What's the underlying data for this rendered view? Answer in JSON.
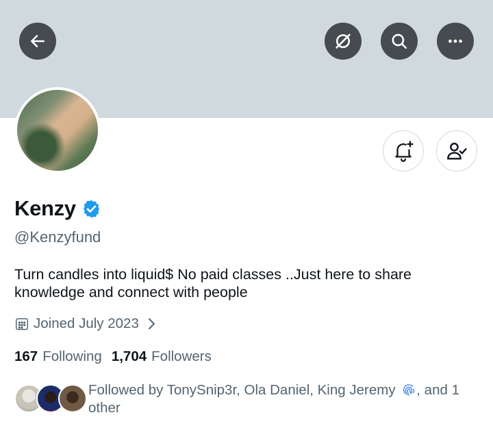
{
  "header": {
    "back_icon": "arrow-left-icon",
    "grok_icon": "grok-icon",
    "search_icon": "search-icon",
    "more_icon": "more-horizontal-icon"
  },
  "profile": {
    "display_name": "Kenzy",
    "handle": "@Kenzyfund",
    "bio_line1": "Turn candles into liquid$ No paid classes  ..Just here to share",
    "bio_line2": "knowledge and connect with people",
    "joined": "Joined July 2023",
    "following_count": "167",
    "following_label": "Following",
    "followers_count": "1,704",
    "followers_label": "Followers",
    "followed_by_prefix": "Followed by TonySnip3r, Ola Daniel, King Jeremy",
    "followed_by_suffix": ", and 1",
    "followed_by_line2": "other"
  },
  "actions": {
    "notify_icon": "bell-plus-icon",
    "following_icon": "person-check-icon"
  },
  "colors": {
    "banner": "#cfd9de",
    "verified": "#1d9bf0",
    "secondary_text": "#536471",
    "primary_text": "#0f1419"
  }
}
